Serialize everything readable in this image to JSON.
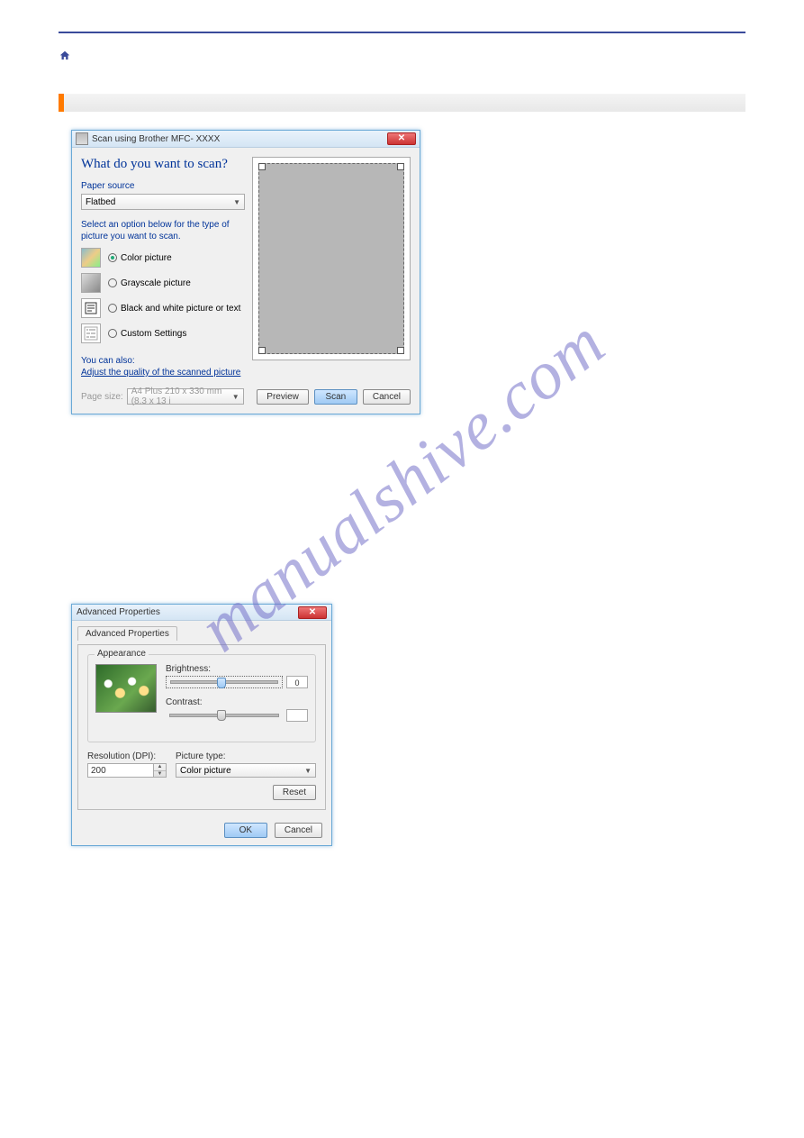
{
  "watermark": "manualshive.com",
  "scan_dialog": {
    "title": "Scan using Brother MFC- XXXX",
    "heading": "What do you want to scan?",
    "paper_source_label": "Paper source",
    "paper_source_value": "Flatbed",
    "instruction": "Select an option below for the type of picture you want to scan.",
    "options": {
      "color": "Color picture",
      "grayscale": "Grayscale picture",
      "bw": "Black and white picture or text",
      "custom": "Custom Settings"
    },
    "also_label": "You can also:",
    "adjust_link": "Adjust the quality of the scanned picture",
    "page_size_label": "Page size:",
    "page_size_value": "A4 Plus 210 x 330 mm (8.3 x 13 i",
    "buttons": {
      "preview": "Preview",
      "scan": "Scan",
      "cancel": "Cancel"
    }
  },
  "adv_dialog": {
    "title": "Advanced Properties",
    "tab": "Advanced Properties",
    "appearance_label": "Appearance",
    "brightness_label": "Brightness:",
    "contrast_label": "Contrast:",
    "brightness_value": "0",
    "contrast_value": "",
    "resolution_label": "Resolution (DPI):",
    "resolution_value": "200",
    "picture_type_label": "Picture type:",
    "picture_type_value": "Color picture",
    "reset": "Reset",
    "ok": "OK",
    "cancel": "Cancel"
  }
}
